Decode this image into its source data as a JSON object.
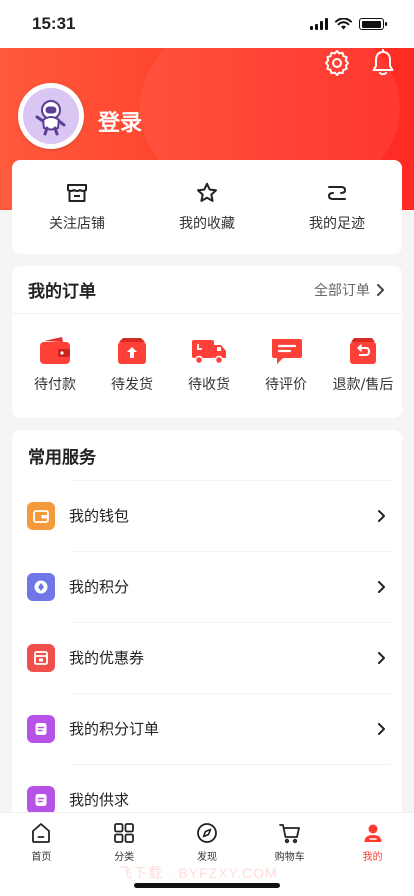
{
  "status_bar": {
    "time": "15:31",
    "battery_level": 0.95
  },
  "header": {
    "login_label": "登录",
    "icons": [
      "settings-icon",
      "bell-icon"
    ],
    "brand_color": "#ff3b30"
  },
  "quick_links": [
    {
      "label": "关注店铺",
      "icon": "store-icon"
    },
    {
      "label": "我的收藏",
      "icon": "star-icon"
    },
    {
      "label": "我的足迹",
      "icon": "footprint-icon"
    }
  ],
  "orders": {
    "title": "我的订单",
    "all_label": "全部订单",
    "items": [
      {
        "label": "待付款",
        "icon": "wallet-icon"
      },
      {
        "label": "待发货",
        "icon": "package-upload-icon"
      },
      {
        "label": "待收货",
        "icon": "truck-icon"
      },
      {
        "label": "待评价",
        "icon": "comment-icon"
      },
      {
        "label": "退款/售后",
        "icon": "refund-icon"
      }
    ]
  },
  "services": {
    "title": "常用服务",
    "items": [
      {
        "label": "我的钱包",
        "icon": "wallet-icon",
        "color": "#f59a3c"
      },
      {
        "label": "我的积分",
        "icon": "points-icon",
        "color": "#6f77e8"
      },
      {
        "label": "我的优惠券",
        "icon": "coupon-icon",
        "color": "#f0504c"
      },
      {
        "label": "我的积分订单",
        "icon": "points-order-icon",
        "color": "#b653e6"
      },
      {
        "label": "我的供求",
        "icon": "supply-demand-icon",
        "color": "#b653e6"
      }
    ]
  },
  "tabbar": {
    "active_index": 4,
    "items": [
      {
        "label": "首页",
        "icon": "home-icon"
      },
      {
        "label": "分类",
        "icon": "category-icon"
      },
      {
        "label": "发现",
        "icon": "compass-icon"
      },
      {
        "label": "购物车",
        "icon": "cart-icon"
      },
      {
        "label": "我的",
        "icon": "profile-icon"
      }
    ]
  },
  "watermark": "飞下载 · BYFZXY.COM"
}
